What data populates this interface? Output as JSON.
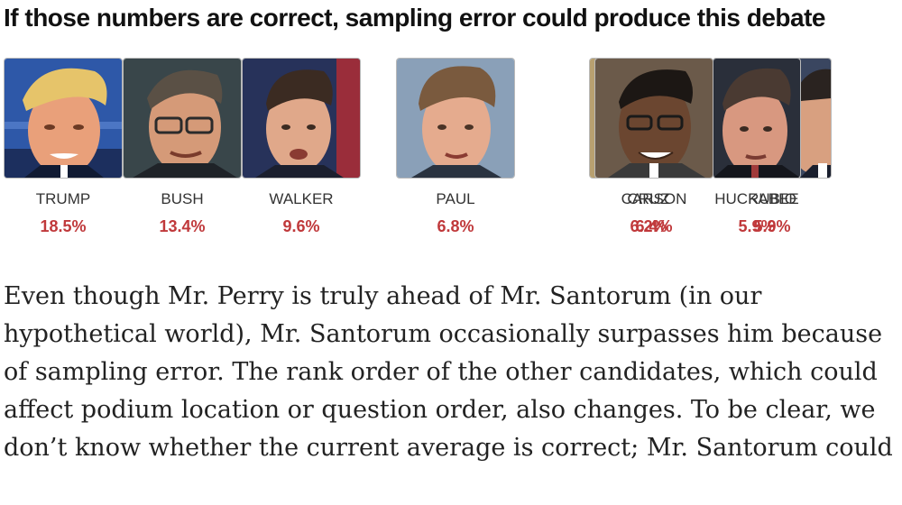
{
  "headline": "If those numbers are correct, sampling error could produce this debate",
  "chart_data": {
    "type": "table",
    "columns": [
      "candidate",
      "share"
    ],
    "candidates": [
      {
        "name": "TRUMP",
        "value": "18.5%",
        "share": 18.5
      },
      {
        "name": "BUSH",
        "value": "13.4%",
        "share": 13.4
      },
      {
        "name": "WALKER",
        "value": "9.6%",
        "share": 9.6
      },
      {
        "name": "PAUL",
        "value": "6.8%",
        "share": 6.8
      },
      {
        "name": "CARSON",
        "value": "6.4%",
        "share": 6.4
      },
      {
        "name": "CRUZ",
        "value": "6.2%",
        "share": 6.2
      },
      {
        "name": "HUCKABEE",
        "value": "5.9%",
        "share": 5.9
      },
      {
        "name": "RUBIO",
        "value": "5.9%",
        "share": 5.9
      }
    ]
  },
  "paragraph": {
    "lines": [
      "Even though Mr. Perry is truly ahead of Mr. Santorum (in our",
      "hypothetical world), Mr. Santorum occasionally surpasses him because",
      "of sampling error. The rank order of the other candidates, which could",
      "affect podium location or question order, also changes. To be clear, we",
      "don’t know whether the current average is correct; Mr. Santorum could"
    ]
  }
}
